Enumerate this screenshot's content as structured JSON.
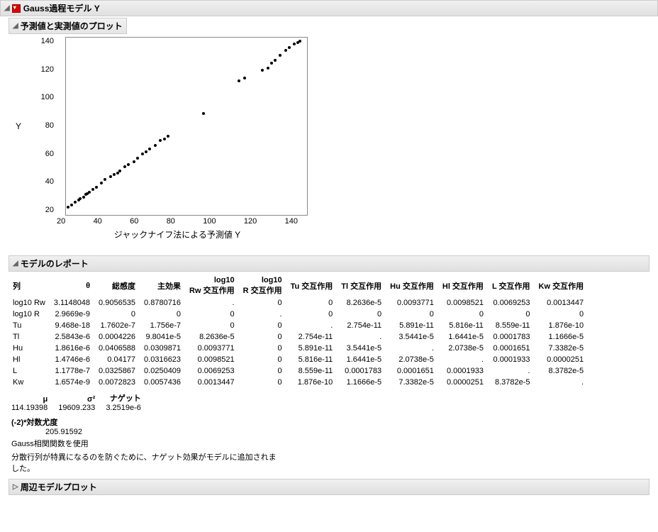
{
  "main_header": "Gauss過程モデル Y",
  "plot_header": "予測値と実測値のプロット",
  "model_report_header": "モデルのレポート",
  "marginal_header": "周辺モデルプロット",
  "chart_data": {
    "type": "scatter",
    "xlabel": "ジャックナイフ法による予測値 Y",
    "ylabel": "Y",
    "x_ticks": [
      "20",
      "40",
      "60",
      "80",
      "100",
      "120",
      "140"
    ],
    "y_ticks": [
      "140",
      "120",
      "100",
      "80",
      "60",
      "40",
      "20"
    ],
    "xlim": [
      15,
      150
    ],
    "ylim": [
      10,
      150
    ],
    "points": [
      {
        "x": 16,
        "y": 16
      },
      {
        "x": 18,
        "y": 18
      },
      {
        "x": 20,
        "y": 20
      },
      {
        "x": 22,
        "y": 22
      },
      {
        "x": 23,
        "y": 23
      },
      {
        "x": 25,
        "y": 24
      },
      {
        "x": 26,
        "y": 26
      },
      {
        "x": 27,
        "y": 27
      },
      {
        "x": 28,
        "y": 28
      },
      {
        "x": 30,
        "y": 30
      },
      {
        "x": 32,
        "y": 32
      },
      {
        "x": 35,
        "y": 35
      },
      {
        "x": 37,
        "y": 38
      },
      {
        "x": 40,
        "y": 40
      },
      {
        "x": 42,
        "y": 42
      },
      {
        "x": 44,
        "y": 43
      },
      {
        "x": 45,
        "y": 45
      },
      {
        "x": 48,
        "y": 48
      },
      {
        "x": 50,
        "y": 50
      },
      {
        "x": 53,
        "y": 52
      },
      {
        "x": 55,
        "y": 55
      },
      {
        "x": 58,
        "y": 58
      },
      {
        "x": 60,
        "y": 60
      },
      {
        "x": 62,
        "y": 62
      },
      {
        "x": 65,
        "y": 65
      },
      {
        "x": 68,
        "y": 69
      },
      {
        "x": 70,
        "y": 70
      },
      {
        "x": 72,
        "y": 72
      },
      {
        "x": 92,
        "y": 90
      },
      {
        "x": 112,
        "y": 116
      },
      {
        "x": 115,
        "y": 118
      },
      {
        "x": 125,
        "y": 124
      },
      {
        "x": 128,
        "y": 126
      },
      {
        "x": 130,
        "y": 130
      },
      {
        "x": 132,
        "y": 132
      },
      {
        "x": 135,
        "y": 136
      },
      {
        "x": 138,
        "y": 140
      },
      {
        "x": 140,
        "y": 142
      },
      {
        "x": 143,
        "y": 145
      },
      {
        "x": 145,
        "y": 146
      },
      {
        "x": 146,
        "y": 147
      }
    ]
  },
  "table": {
    "col_label": "列",
    "headers": [
      "θ",
      "総感度",
      "主効果",
      "log10\nRw 交互作用",
      "log10\nR 交互作用",
      "Tu 交互作用",
      "Tl 交互作用",
      "Hu 交互作用",
      "Hl 交互作用",
      "L 交互作用",
      "Kw 交互作用"
    ],
    "rows": [
      {
        "label": "log10 Rw",
        "vals": [
          "3.1148048",
          "0.9056535",
          "0.8780716",
          ".",
          "0",
          "0",
          "8.2636e-5",
          "0.0093771",
          "0.0098521",
          "0.0069253",
          "0.0013447"
        ]
      },
      {
        "label": "log10 R",
        "vals": [
          "2.9669e-9",
          "0",
          "0",
          "0",
          ".",
          "0",
          "0",
          "0",
          "0",
          "0",
          "0"
        ]
      },
      {
        "label": "Tu",
        "vals": [
          "9.468e-18",
          "1.7602e-7",
          "1.756e-7",
          "0",
          "0",
          ".",
          "2.754e-11",
          "5.891e-11",
          "5.816e-11",
          "8.559e-11",
          "1.876e-10"
        ]
      },
      {
        "label": "Tl",
        "vals": [
          "2.5843e-6",
          "0.0004226",
          "9.8041e-5",
          "8.2636e-5",
          "0",
          "2.754e-11",
          ".",
          "3.5441e-5",
          "1.6441e-5",
          "0.0001783",
          "1.1666e-5"
        ]
      },
      {
        "label": "Hu",
        "vals": [
          "1.8616e-6",
          "0.0406588",
          "0.0309871",
          "0.0093771",
          "0",
          "5.891e-11",
          "3.5441e-5",
          ".",
          "2.0738e-5",
          "0.0001651",
          "7.3382e-5"
        ]
      },
      {
        "label": "Hl",
        "vals": [
          "1.4746e-6",
          "0.04177",
          "0.0316623",
          "0.0098521",
          "0",
          "5.816e-11",
          "1.6441e-5",
          "2.0738e-5",
          ".",
          "0.0001933",
          "0.0000251"
        ]
      },
      {
        "label": "L",
        "vals": [
          "1.1778e-7",
          "0.0325867",
          "0.0250409",
          "0.0069253",
          "0",
          "8.559e-11",
          "0.0001783",
          "0.0001651",
          "0.0001933",
          ".",
          "8.3782e-5"
        ]
      },
      {
        "label": "Kw",
        "vals": [
          "1.6574e-9",
          "0.0072823",
          "0.0057436",
          "0.0013447",
          "0",
          "1.876e-10",
          "1.1666e-5",
          "7.3382e-5",
          "0.0000251",
          "8.3782e-5",
          "."
        ]
      }
    ]
  },
  "stats": {
    "mu_label": "μ",
    "mu": "114.19398",
    "sigma2_label": "σ²",
    "sigma2": "19609.233",
    "nugget_label": "ナゲット",
    "nugget": "3.2519e-6",
    "logL_label": "(-2)*対数尤度",
    "logL": "205.91592"
  },
  "note1": "Gauss相関関数を使用",
  "note2": "分散行列が特異になるのを防ぐために、ナゲット効果がモデルに追加されました。"
}
